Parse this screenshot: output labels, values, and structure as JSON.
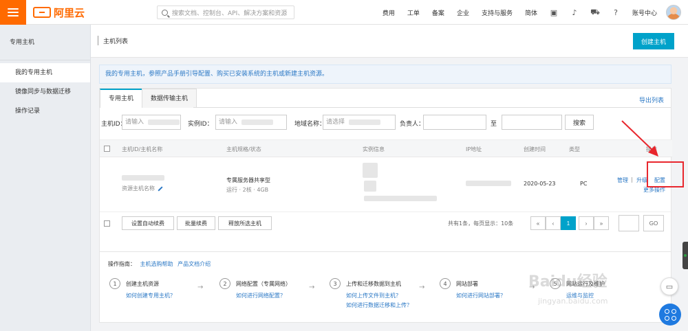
{
  "topbar": {
    "logo_text": "阿里云",
    "search_placeholder": "搜索文档、控制台、API、解决方案和资源",
    "nav": [
      "费用",
      "工单",
      "备案",
      "企业",
      "支持与服务"
    ],
    "nav_extra": "简体",
    "user_name": "账号中心",
    "icons": [
      "screen-icon",
      "bell-icon",
      "cart-icon",
      "help-icon"
    ]
  },
  "sidebar": {
    "header": "专用主机",
    "items": [
      {
        "label": "我的专用主机",
        "active": true
      },
      {
        "label": "镜像同步与数据迁移",
        "active": false
      },
      {
        "label": "操作记录",
        "active": false
      }
    ]
  },
  "titlebar": {
    "title": "主机列表",
    "create_button": "创建主机"
  },
  "notice": "我的专用主机，参照产品手册引导配置、购买已安装系统的主机或新建主机资源。",
  "tabs": [
    {
      "label": "专用主机",
      "active": true
    },
    {
      "label": "数据传输主机",
      "active": false
    }
  ],
  "export_label": "导出列表",
  "filters": {
    "host_id_label": "主机ID：",
    "host_id_value": "请输入",
    "instance_label": "实例ID：",
    "instance_value": "请输入",
    "region_label": "地域名称：",
    "region_value": "请选择",
    "owner_label": "负责人：",
    "range_label": "至",
    "search_button": "搜索"
  },
  "table": {
    "headers": [
      "主机ID/主机名称",
      "主机规格/状态",
      "实例信息",
      "IP地址",
      "创建时间",
      "类型",
      "操作"
    ],
    "rows": [
      {
        "host_name": "资源主机名称",
        "spec": "专属服务器共享型",
        "status_line": "运行 · 2核 · 4GB",
        "created": "2020-05-23",
        "type": "PC",
        "actions": [
          "管理",
          "升级",
          "配置"
        ],
        "action_extra": "更多操作"
      }
    ]
  },
  "batch": {
    "buttons": [
      "设置自动续费",
      "批量续费",
      "释放所选主机"
    ],
    "pager_text": "共有1条，每页显示：10条",
    "pages": [
      "«",
      "‹",
      "1",
      "›",
      "»"
    ],
    "current_page": "1",
    "goto_button": "GO"
  },
  "guide": {
    "title": "操作指南：",
    "links": [
      "主机选购帮助",
      "产品文档介绍"
    ],
    "steps": [
      {
        "num": "1",
        "title": "创建主机资源",
        "links": [
          "如何创建专用主机？"
        ]
      },
      {
        "num": "2",
        "title": "网络配置（专属网络）",
        "links": [
          "如何进行网络配置？"
        ]
      },
      {
        "num": "3",
        "title": "上传和迁移数据到主机",
        "links": [
          "如何上传文件到主机？",
          "如何进行数据迁移和上传？"
        ]
      },
      {
        "num": "4",
        "title": "网站部署",
        "links": [
          "如何进行网站部署？"
        ]
      },
      {
        "num": "5",
        "title": "网站运行及维护",
        "links": [
          "运维与监控"
        ]
      }
    ]
  },
  "watermark": {
    "main": "Baidu经验",
    "sub": "jingyan.baidu.com"
  },
  "colors": {
    "brand": "#ff6a00",
    "primary": "#00a2ca",
    "link": "#2b78c5",
    "highlight": "#e8262d"
  }
}
